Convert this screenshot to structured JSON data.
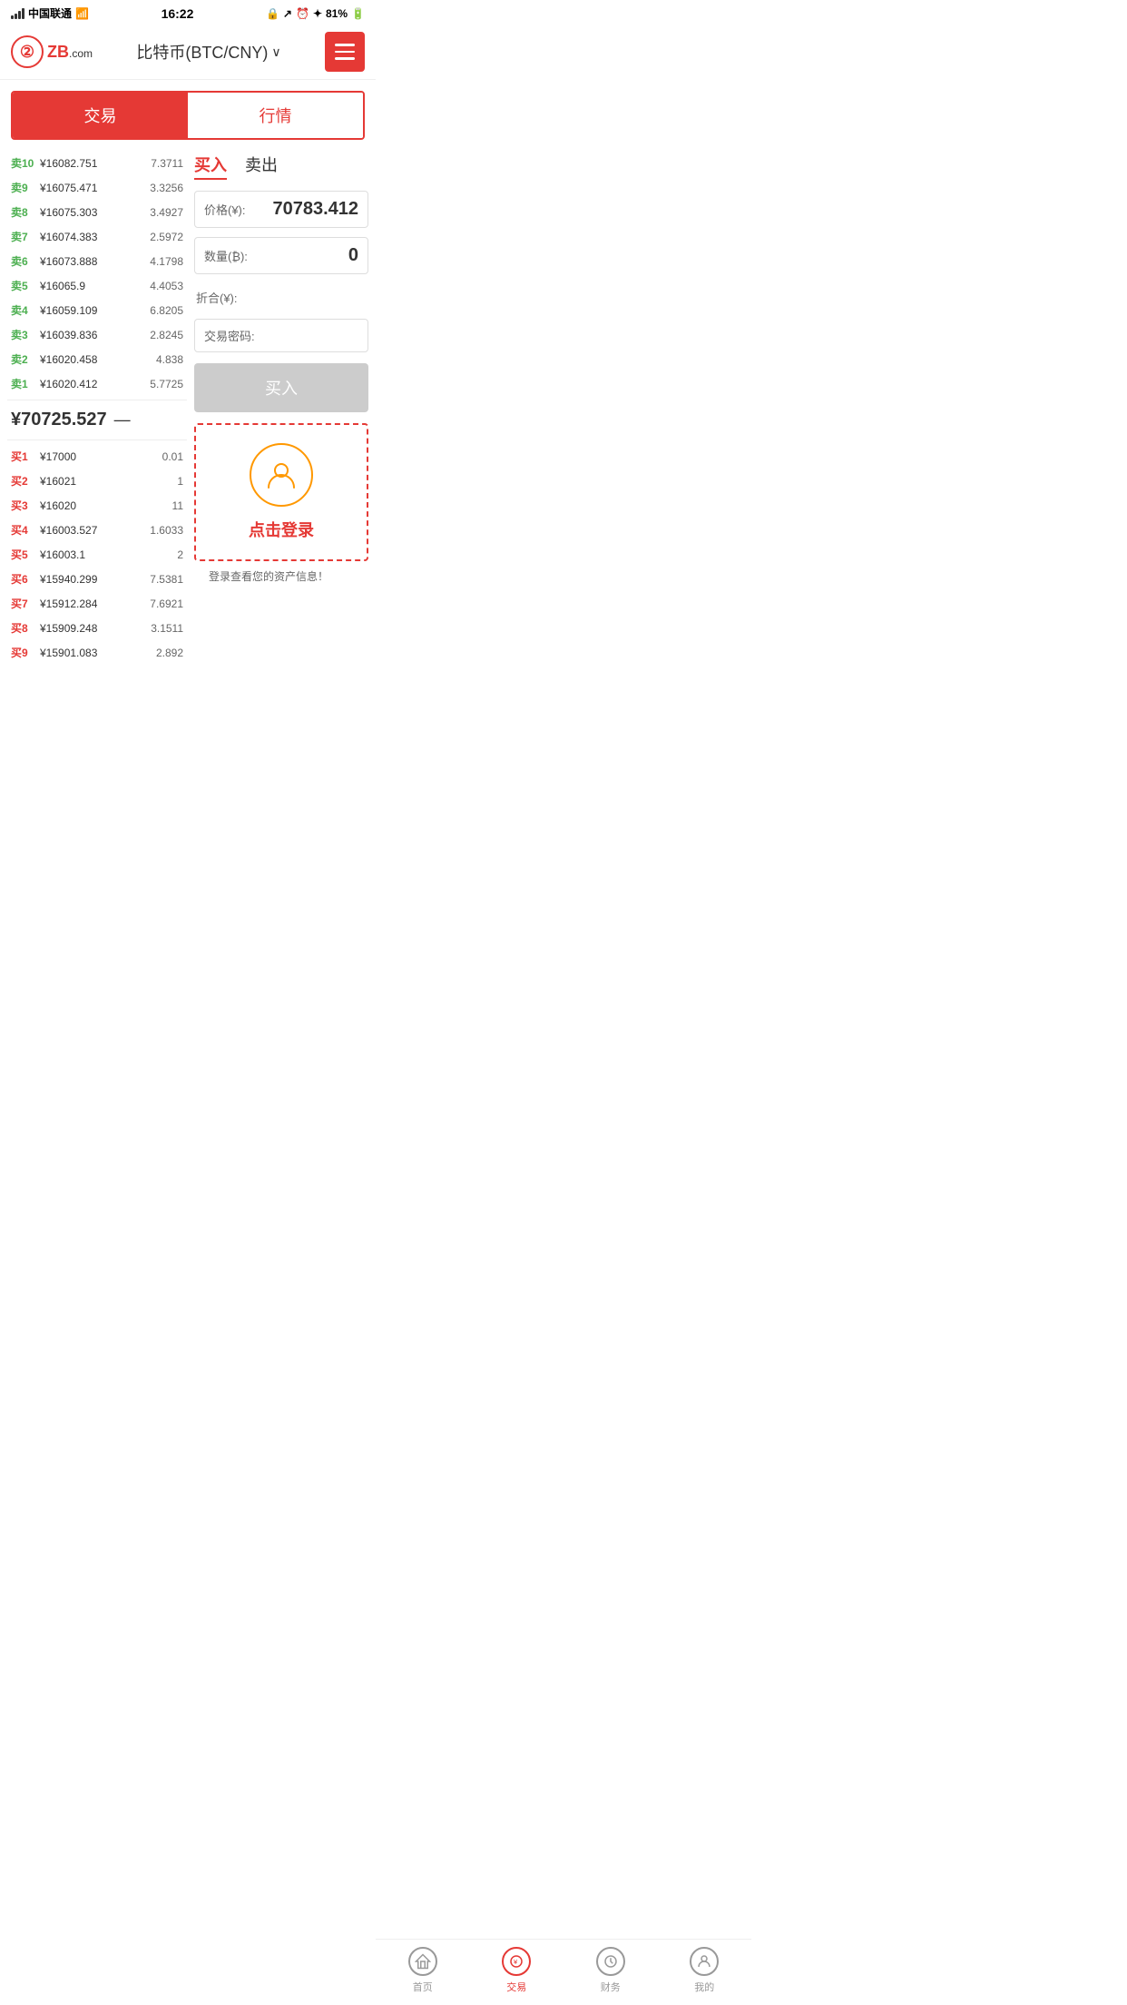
{
  "statusBar": {
    "carrier": "中国联通",
    "time": "16:22",
    "battery": "81%"
  },
  "header": {
    "logo": "ZB",
    "com": ".com",
    "title": "比特币(BTC/CNY)",
    "dropdown": "∨"
  },
  "tabs": {
    "tab1": "交易",
    "tab2": "行情",
    "active": "tab1"
  },
  "orderBook": {
    "sells": [
      {
        "label": "卖10",
        "price": "¥16082.751",
        "qty": "7.3711"
      },
      {
        "label": "卖9",
        "price": "¥16075.471",
        "qty": "3.3256"
      },
      {
        "label": "卖8",
        "price": "¥16075.303",
        "qty": "3.4927"
      },
      {
        "label": "卖7",
        "price": "¥16074.383",
        "qty": "2.5972"
      },
      {
        "label": "卖6",
        "price": "¥16073.888",
        "qty": "4.1798"
      },
      {
        "label": "卖5",
        "price": "¥16065.9",
        "qty": "4.4053"
      },
      {
        "label": "卖4",
        "price": "¥16059.109",
        "qty": "6.8205"
      },
      {
        "label": "卖3",
        "price": "¥16039.836",
        "qty": "2.8245"
      },
      {
        "label": "卖2",
        "price": "¥16020.458",
        "qty": "4.838"
      },
      {
        "label": "卖1",
        "price": "¥16020.412",
        "qty": "5.7725"
      }
    ],
    "currentPrice": "¥70725.527",
    "currentPriceIcon": "—",
    "buys": [
      {
        "label": "买1",
        "price": "¥17000",
        "qty": "0.01"
      },
      {
        "label": "买2",
        "price": "¥16021",
        "qty": "1"
      },
      {
        "label": "买3",
        "price": "¥16020",
        "qty": "11"
      },
      {
        "label": "买4",
        "price": "¥16003.527",
        "qty": "1.6033"
      },
      {
        "label": "买5",
        "price": "¥16003.1",
        "qty": "2"
      },
      {
        "label": "买6",
        "price": "¥15940.299",
        "qty": "7.5381"
      },
      {
        "label": "买7",
        "price": "¥15912.284",
        "qty": "7.6921"
      },
      {
        "label": "买8",
        "price": "¥15909.248",
        "qty": "3.1511"
      },
      {
        "label": "买9",
        "price": "¥15901.083",
        "qty": "2.892"
      }
    ]
  },
  "tradePanel": {
    "buyTab": "买入",
    "sellTab": "卖出",
    "priceLabel": "价格(¥):",
    "priceValue": "70783.412",
    "qtyLabel": "数量(₿):",
    "qtyValue": "0",
    "foldLabel": "折合(¥):",
    "passwordLabel": "交易密码:",
    "buyButton": "买入",
    "loginText": "点击登录",
    "assetInfo": "登录查看您的资产信息！"
  },
  "bottomNav": {
    "items": [
      {
        "label": "首页",
        "icon": "star",
        "active": false
      },
      {
        "label": "交易",
        "icon": "yuan",
        "active": true
      },
      {
        "label": "财务",
        "icon": "money",
        "active": false
      },
      {
        "label": "我的",
        "icon": "person",
        "active": false
      }
    ]
  }
}
